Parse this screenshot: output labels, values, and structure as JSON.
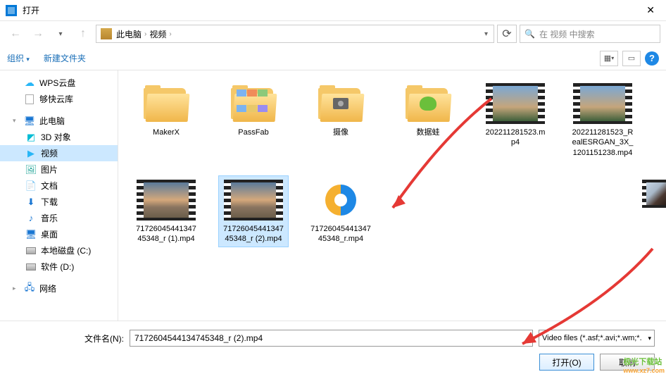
{
  "window": {
    "title": "打开"
  },
  "nav": {
    "breadcrumb": [
      "此电脑",
      "视频"
    ],
    "search_placeholder": "在 视频 中搜索"
  },
  "toolbar": {
    "organize": "组织",
    "new_folder": "新建文件夹"
  },
  "sidebar": {
    "items": [
      {
        "label": "WPS云盘",
        "icon": "cloud"
      },
      {
        "label": "够快云库",
        "icon": "doc"
      },
      {
        "label": "此电脑",
        "icon": "pc",
        "expandable": true
      },
      {
        "label": "3D 对象",
        "icon": "3d",
        "level": 2
      },
      {
        "label": "视频",
        "icon": "video",
        "level": 2,
        "selected": true
      },
      {
        "label": "图片",
        "icon": "img",
        "level": 2
      },
      {
        "label": "文档",
        "icon": "docfolder",
        "level": 2
      },
      {
        "label": "下载",
        "icon": "dl",
        "level": 2
      },
      {
        "label": "音乐",
        "icon": "music",
        "level": 2
      },
      {
        "label": "桌面",
        "icon": "desk",
        "level": 2
      },
      {
        "label": "本地磁盘 (C:)",
        "icon": "disk",
        "level": 2
      },
      {
        "label": "软件 (D:)",
        "icon": "disk",
        "level": 2
      },
      {
        "label": "网络",
        "icon": "net",
        "expandable": true
      }
    ]
  },
  "files": [
    {
      "name": "MakerX",
      "type": "folder"
    },
    {
      "name": "PassFab",
      "type": "folder-media"
    },
    {
      "name": "摄像",
      "type": "folder-camera"
    },
    {
      "name": "数据蛙",
      "type": "folder-frog"
    },
    {
      "name": "202211281523.mp4",
      "type": "video",
      "thumb": "sky1"
    },
    {
      "name": "202211281523_RealESRGAN_3X_1201151238.mp4",
      "type": "video",
      "thumb": "sky1"
    },
    {
      "name": "7172604544134745348_r (1).mp4",
      "type": "video",
      "thumb": "sky2"
    },
    {
      "name": "7172604544134745348_r (2).mp4",
      "type": "video",
      "thumb": "sky2",
      "selected": true
    },
    {
      "name": "7172604544134745348_r.mp4",
      "type": "app"
    }
  ],
  "edge_file": {
    "thumb": "sky3"
  },
  "bottom": {
    "filename_label": "文件名(N):",
    "filename_value": "7172604544134745348_r (2).mp4",
    "filetype": "Video files (*.asf;*.avi;*.wm;*.",
    "open": "打开(O)",
    "cancel": "取消"
  },
  "watermark": {
    "site": "极光下载站",
    "url": "www.xz7.com"
  }
}
